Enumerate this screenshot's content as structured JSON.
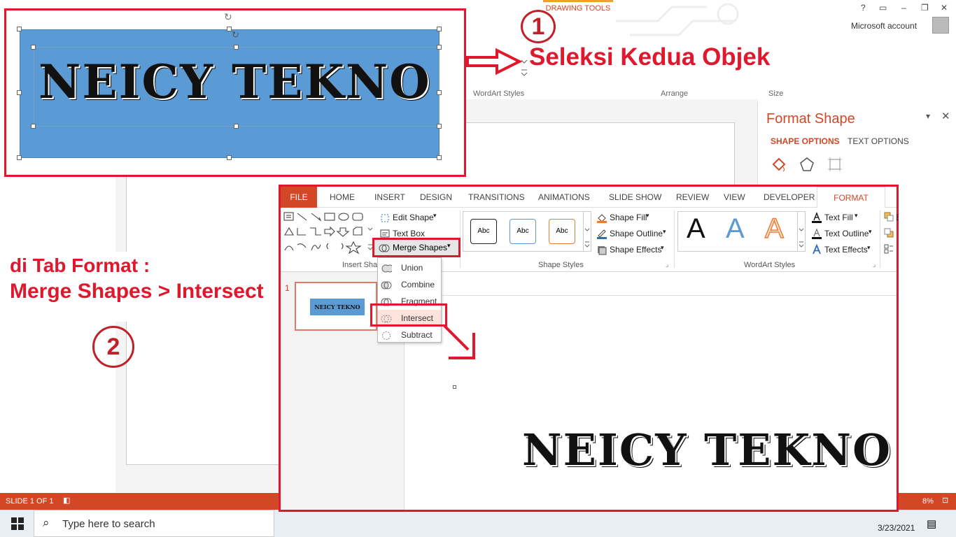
{
  "background_app": {
    "drawing_tools_label": "DRAWING TOOLS",
    "help_label": "?",
    "account_label": "Microsoft account",
    "group_labels": {
      "wordart": "WordArt Styles",
      "arrange": "Arrange",
      "size": "Size"
    },
    "format_pane": {
      "title": "Format Shape",
      "tab_shape": "SHAPE OPTIONS",
      "tab_text": "TEXT OPTIONS"
    },
    "status": {
      "slide": "SLIDE 1 OF 1",
      "zoom": "8%"
    },
    "taskbar": {
      "search_placeholder": "Type here to search",
      "date": "3/23/2021"
    }
  },
  "step1": {
    "number": "1",
    "instruction": "Seleksi Kedua Objek",
    "shape_text": "NEICY TEKNO"
  },
  "step2": {
    "number": "2",
    "line1": "di Tab Format :",
    "line2": "Merge Shapes > Intersect"
  },
  "ribbon": {
    "tabs": [
      "FILE",
      "HOME",
      "INSERT",
      "DESIGN",
      "TRANSITIONS",
      "ANIMATIONS",
      "SLIDE SHOW",
      "REVIEW",
      "VIEW",
      "DEVELOPER",
      "FORMAT"
    ],
    "insert_shapes": {
      "edit_shape": "Edit Shape",
      "text_box": "Text Box",
      "merge_shapes": "Merge Shapes",
      "group_label": "Insert Sha"
    },
    "shape_styles": {
      "sample": "Abc",
      "fill": "Shape Fill",
      "outline": "Shape Outline",
      "effects": "Shape Effects",
      "group_label": "Shape Styles"
    },
    "wordart": {
      "letter": "A",
      "text_fill": "Text Fill",
      "text_outline": "Text Outline",
      "text_effects": "Text Effects",
      "group_label": "WordArt Styles"
    },
    "arrange": {
      "bring": "Bring F",
      "send": "Send B",
      "selection": "Selecti"
    }
  },
  "merge_menu": {
    "items": [
      "Union",
      "Combine",
      "Fragment",
      "Intersect",
      "Subtract"
    ],
    "selected": "Intersect"
  },
  "thumbnail": {
    "number": "1",
    "text": "NEICY TEKNO"
  },
  "result_text": "NEICY TEKNO",
  "colors": {
    "accent": "#d24726",
    "highlight": "#e0182d",
    "shape_fill": "#5b9bd5"
  }
}
